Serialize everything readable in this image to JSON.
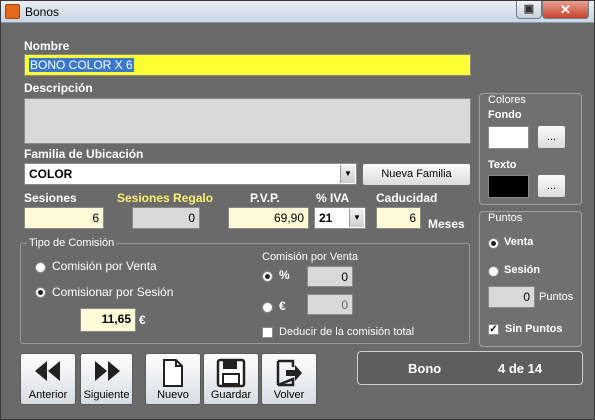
{
  "window": {
    "title": "Bonos"
  },
  "form": {
    "nombre_label": "Nombre",
    "nombre_value": "BONO COLOR X 6",
    "descripcion_label": "Descripción",
    "descripcion_value": "",
    "familia_label": "Familia de Ubicación",
    "familia_value": "COLOR",
    "nueva_familia_button": "Nueva Familia",
    "sesiones_label": "Sesiones",
    "sesiones_value": "6",
    "sesiones_regalo_label": "Sesiones Regalo",
    "sesiones_regalo_value": "0",
    "pvp_label": "P.V.P.",
    "pvp_value": "69,90",
    "iva_label": "% IVA",
    "iva_value": "21",
    "caducidad_label": "Caducidad",
    "caducidad_value": "6",
    "caducidad_unit": "Meses"
  },
  "comision": {
    "group_title": "Tipo de Comisión",
    "option_venta": "Comisión por Venta",
    "option_sesion": "Comisionar por Sesión",
    "selected": "sesion",
    "sesion_amount": "11,65",
    "currency": "€",
    "venta_group_label": "Comisión por Venta",
    "pct_symbol": "%",
    "pct_value": "0",
    "euro_symbol": "€",
    "euro_value": "0",
    "deducir_label": "Deducir de la comisión total",
    "deducir_checked": false
  },
  "colores": {
    "group_title": "Colores",
    "fondo_label": "Fondo",
    "texto_label": "Texto",
    "picker_button": "...",
    "fondo_color": "#ffffff",
    "texto_color": "#000000"
  },
  "puntos": {
    "group_title": "Puntos",
    "venta_label": "Venta",
    "sesion_label": "Sesión",
    "selected": "venta",
    "value": "0",
    "unit": "Puntos",
    "sin_puntos_label": "Sin Puntos",
    "sin_puntos_checked": true
  },
  "toolbar": {
    "anterior": "Anterior",
    "siguiente": "Siguiente",
    "nuevo": "Nuevo",
    "guardar": "Guardar",
    "volver": "Volver"
  },
  "record": {
    "name": "Bono",
    "position": "4 de 14"
  },
  "icons": {
    "previous": "rewind-icon",
    "next": "fast-forward-icon",
    "new": "new-document-icon",
    "save": "floppy-disk-icon",
    "exit": "exit-door-icon"
  }
}
